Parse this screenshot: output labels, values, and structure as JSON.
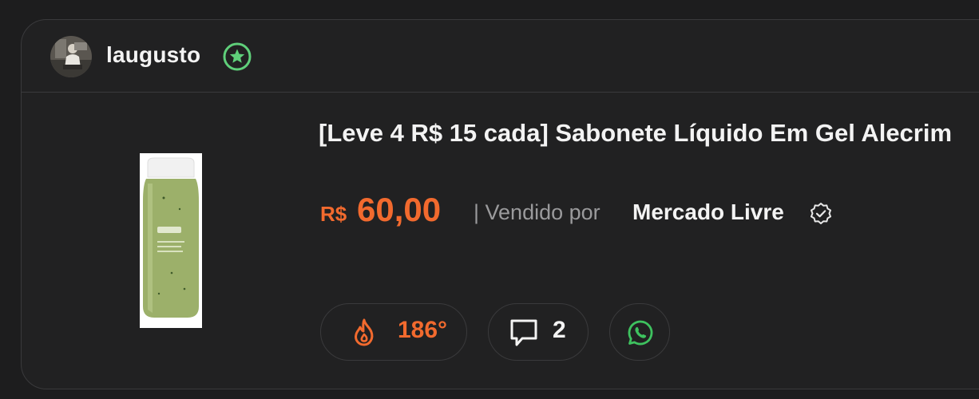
{
  "post": {
    "username": "laugusto",
    "title": "[Leve 4 R$ 15 cada] Sabonete Líquido Em Gel Alecrim",
    "currency": "R$",
    "price": "60,00",
    "sold_by_text": "| Vendido por",
    "seller": "Mercado Livre",
    "temperature": "186°",
    "comments": "2"
  },
  "icons": {
    "star_badge": "star-badge-icon",
    "verified": "verified-icon",
    "fire": "fire-icon",
    "comment": "comment-icon",
    "whatsapp": "whatsapp-icon"
  },
  "colors": {
    "accent_orange": "#f26a2e",
    "badge_green": "#5fcf7a",
    "whatsapp_green": "#3ec25f",
    "background": "#1d1d1e",
    "card": "#212122"
  }
}
